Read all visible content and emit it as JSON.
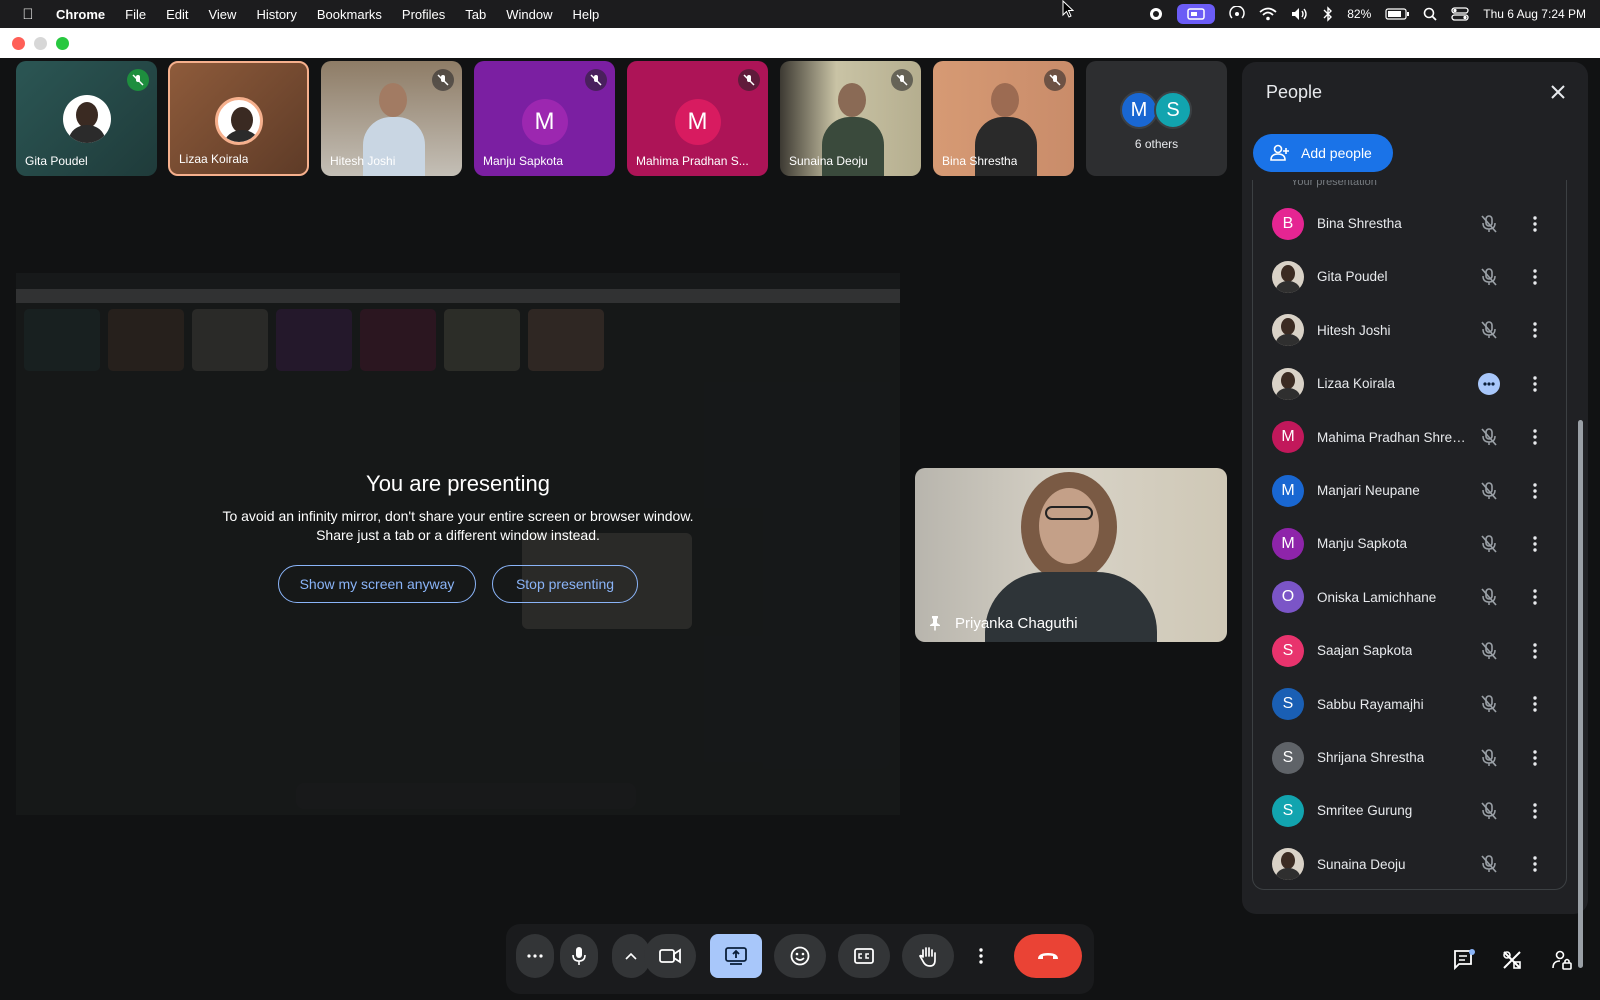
{
  "menubar": {
    "app": "Chrome",
    "items": [
      "File",
      "Edit",
      "View",
      "History",
      "Bookmarks",
      "Profiles",
      "Tab",
      "Window",
      "Help"
    ],
    "battery": "82%",
    "datetime": "Thu 6 Aug  7:24 PM"
  },
  "tiles": [
    {
      "name": "Gita Poudel",
      "kind": "photo",
      "bg": "#2f5a58",
      "muted": true
    },
    {
      "name": "Lizaa Koirala",
      "kind": "photo-ring",
      "bg": "#8a5a3c",
      "muted": false,
      "active": true
    },
    {
      "name": "Hitesh Joshi",
      "kind": "video",
      "bg": "#a99d8d",
      "muted": true
    },
    {
      "name": "Manju Sapkota",
      "kind": "letter",
      "letter": "M",
      "bg": "#7b1fa2",
      "avatar": "#8e24aa",
      "muted": true
    },
    {
      "name": "Mahima Pradhan S...",
      "kind": "letter",
      "letter": "M",
      "bg": "#ad1457",
      "avatar": "#c2185b",
      "muted": true
    },
    {
      "name": "Sunaina Deoju",
      "kind": "video",
      "bg": "#b7b08e",
      "muted": true
    },
    {
      "name": "Bina Shrestha",
      "kind": "video",
      "bg": "#c98c6a",
      "muted": true
    }
  ],
  "others": {
    "label": "6 others",
    "a1": "M",
    "a2": "S"
  },
  "presenting": {
    "title": "You are presenting",
    "message_line1": "To avoid an infinity mirror, don't share your entire screen or browser window.",
    "message_line2": "Share just a tab or a different window instead.",
    "show_anyway": "Show my screen anyway",
    "stop": "Stop presenting"
  },
  "pinned": {
    "name": "Priyanka Chaguthi"
  },
  "panel": {
    "title": "People",
    "add_people": "Add people",
    "cut_label": "Your presentation",
    "people": [
      {
        "name": "Bina Shrestha",
        "letter": "B",
        "color": "#e52592",
        "photo": false,
        "speaking": false
      },
      {
        "name": "Gita Poudel",
        "letter": "",
        "color": "#d9d2c7",
        "photo": true,
        "speaking": false
      },
      {
        "name": "Hitesh Joshi",
        "letter": "",
        "color": "#d9d2c7",
        "photo": true,
        "speaking": false
      },
      {
        "name": "Lizaa Koirala",
        "letter": "",
        "color": "#d9d2c7",
        "photo": true,
        "speaking": true
      },
      {
        "name": "Mahima Pradhan Shrest...",
        "letter": "M",
        "color": "#c2185b",
        "photo": false,
        "speaking": false
      },
      {
        "name": "Manjari Neupane",
        "letter": "M",
        "color": "#1967d2",
        "photo": false,
        "speaking": false
      },
      {
        "name": "Manju Sapkota",
        "letter": "M",
        "color": "#8e24aa",
        "photo": false,
        "speaking": false
      },
      {
        "name": "Oniska Lamichhane",
        "letter": "O",
        "color": "#7b55c7",
        "photo": false,
        "speaking": false
      },
      {
        "name": "Saajan Sapkota",
        "letter": "S",
        "color": "#e8336d",
        "photo": false,
        "speaking": false
      },
      {
        "name": "Sabbu Rayamajhi",
        "letter": "S",
        "color": "#1a5fb4",
        "photo": false,
        "speaking": false
      },
      {
        "name": "Shrijana Shrestha",
        "letter": "S",
        "color": "#5f6368",
        "photo": false,
        "speaking": false
      },
      {
        "name": "Smritee Gurung",
        "letter": "S",
        "color": "#12a4af",
        "photo": false,
        "speaking": false
      },
      {
        "name": "Sunaina Deoju",
        "letter": "",
        "color": "#d9d2c7",
        "photo": true,
        "speaking": false
      }
    ]
  },
  "colors": {
    "accent": "#8ab4f8",
    "end_call": "#ea4335",
    "panel_bg": "#202124"
  }
}
